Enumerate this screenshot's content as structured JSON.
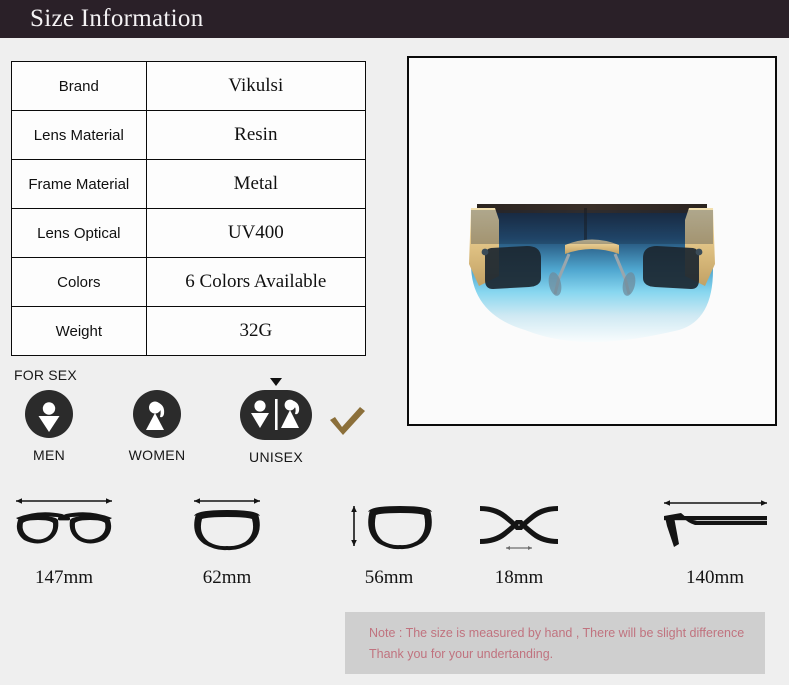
{
  "header": {
    "title": "Size Information"
  },
  "spec_table": {
    "rows": [
      {
        "label": "Brand",
        "value": "Vikulsi"
      },
      {
        "label": "Lens Material",
        "value": "Resin"
      },
      {
        "label": "Frame Material",
        "value": "Metal"
      },
      {
        "label": "Lens Optical",
        "value": "UV400"
      },
      {
        "label": "Colors",
        "value": "6 Colors Available"
      },
      {
        "label": "Weight",
        "value": "32G"
      }
    ]
  },
  "product_photo": {
    "alt": "oversized shield sunglasses with blue gradient lens and gold metal frame",
    "lens_gradient": [
      "#1d2b42",
      "#2f7fae",
      "#6fd0ec",
      "#d8eef6",
      "#f7fbfc"
    ],
    "frame_color": "#e2c98d",
    "temple_color": "#1b2630"
  },
  "for_sex": {
    "section_label": "FOR SEX",
    "options": [
      {
        "label": "MEN",
        "icon": "male-figure-icon",
        "selected": false
      },
      {
        "label": "WOMEN",
        "icon": "female-figure-icon",
        "selected": false
      },
      {
        "label": "UNISEX",
        "icon": "unisex-figures-icon",
        "selected": true
      }
    ],
    "selected_marker": "check-mark-icon",
    "check_color": "#8b6f3a",
    "badge_color": "#2b2b2b"
  },
  "measurements": [
    {
      "value": "147mm",
      "icon": "frame-total-width-icon"
    },
    {
      "value": "62mm",
      "icon": "lens-width-icon"
    },
    {
      "value": "56mm",
      "icon": "lens-height-icon"
    },
    {
      "value": "18mm",
      "icon": "bridge-width-icon"
    },
    {
      "value": "140mm",
      "icon": "temple-length-icon"
    }
  ],
  "note": {
    "line1": "Note : The size is measured by hand , There will be slight difference",
    "line2": "Thank you for your undertanding.",
    "text_color": "#c0737f",
    "background_color": "#cfcfcf"
  },
  "theme": {
    "page_background": "#efefef",
    "header_background": "#2a2028",
    "header_text": "#f4f2f4",
    "table_border": "#0a0a0a"
  }
}
